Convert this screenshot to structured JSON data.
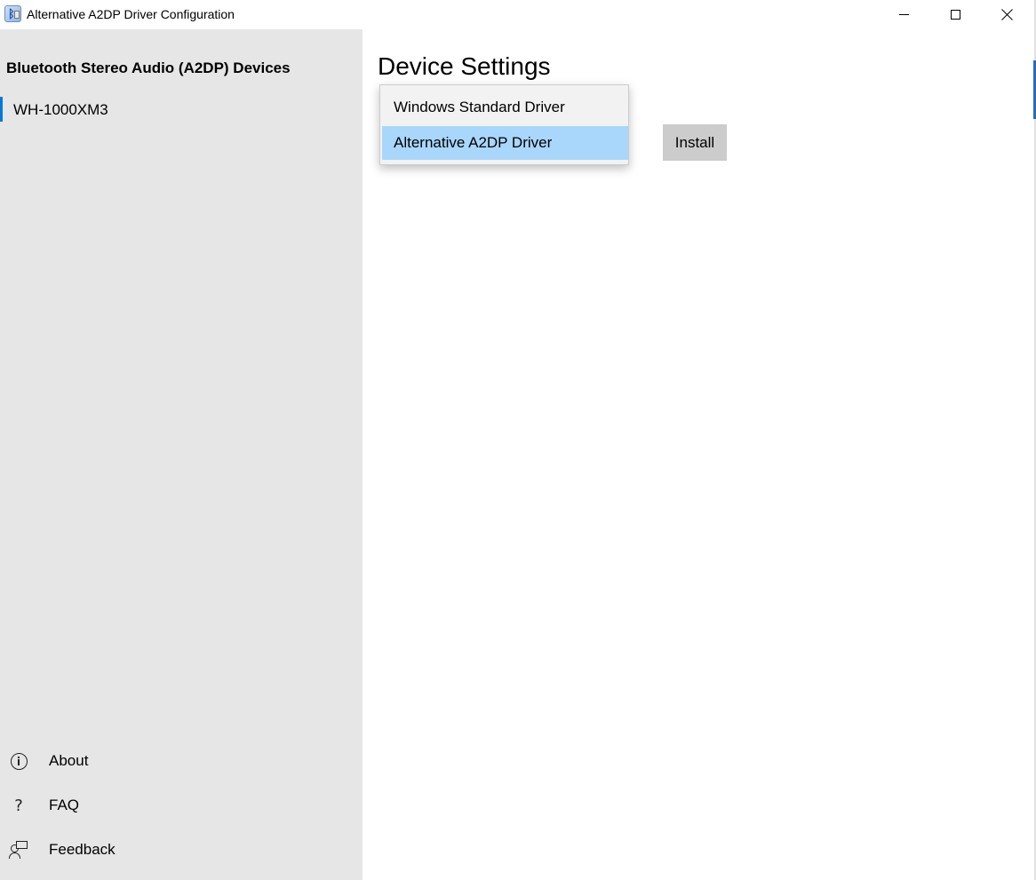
{
  "window": {
    "title": "Alternative A2DP Driver Configuration",
    "icon": "bluetooth-speaker-icon",
    "controls": [
      "minimize-icon",
      "maximize-icon",
      "close-icon"
    ]
  },
  "sidebar": {
    "heading": "Bluetooth Stereo Audio (A2DP) Devices",
    "devices": [
      {
        "label": "WH-1000XM3",
        "selected": true
      }
    ],
    "nav": [
      {
        "label": "About",
        "icon": "info-icon"
      },
      {
        "label": "FAQ",
        "icon": "question-icon"
      },
      {
        "label": "Feedback",
        "icon": "feedback-icon"
      }
    ]
  },
  "main": {
    "title": "Device Settings",
    "driver_dropdown": {
      "options": [
        "Windows Standard Driver",
        "Alternative A2DP Driver"
      ],
      "highlighted": "Alternative A2DP Driver"
    },
    "install_label": "Install"
  },
  "colors": {
    "accent": "#0078d7",
    "sidebar_bg": "#e6e6e6",
    "highlight": "#a9d6fb",
    "button_bg": "#cccccc"
  }
}
